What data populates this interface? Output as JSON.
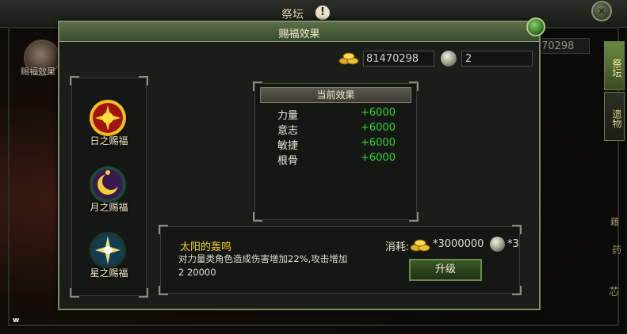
{
  "background_window": {
    "title": "祭坛",
    "help_label": "!",
    "avatar_label": "赐福效果",
    "gold_readout": "70298",
    "tabs": [
      {
        "label": "祭坛"
      },
      {
        "label": "遗物"
      }
    ],
    "bottom_marker": "w",
    "right_fragments": [
      "藉",
      "药",
      "芯"
    ]
  },
  "dialog": {
    "title": "赐福效果",
    "currency": {
      "gold": "81470298",
      "orb": "2",
      "gold_icon": "gold-ingots-icon",
      "orb_icon": "silver-orb-icon"
    },
    "blessings": [
      {
        "label": "日之赐福",
        "icon": "sun-emblem-icon",
        "selected": true
      },
      {
        "label": "月之赐福",
        "icon": "moon-emblem-icon",
        "selected": false
      },
      {
        "label": "星之赐福",
        "icon": "star-emblem-icon",
        "selected": false
      }
    ],
    "current_effects": {
      "header": "当前效果",
      "stats": [
        {
          "name": "力量",
          "value": "+6000"
        },
        {
          "name": "意志",
          "value": "+6000"
        },
        {
          "name": "敏捷",
          "value": "+6000"
        },
        {
          "name": "根骨",
          "value": "+6000"
        }
      ]
    },
    "skill": {
      "name": "太阳的轰鸣",
      "description": "对力量类角色造成伤害增加22%,攻击增加2 20000",
      "cost_label": "消耗:",
      "cost_gold": "*3000000",
      "cost_orb": "*3",
      "upgrade_label": "升级"
    }
  },
  "colors": {
    "stat_value": "#30d830",
    "skill_name": "#f0d030",
    "frame_accent": "#7c8a6a"
  }
}
